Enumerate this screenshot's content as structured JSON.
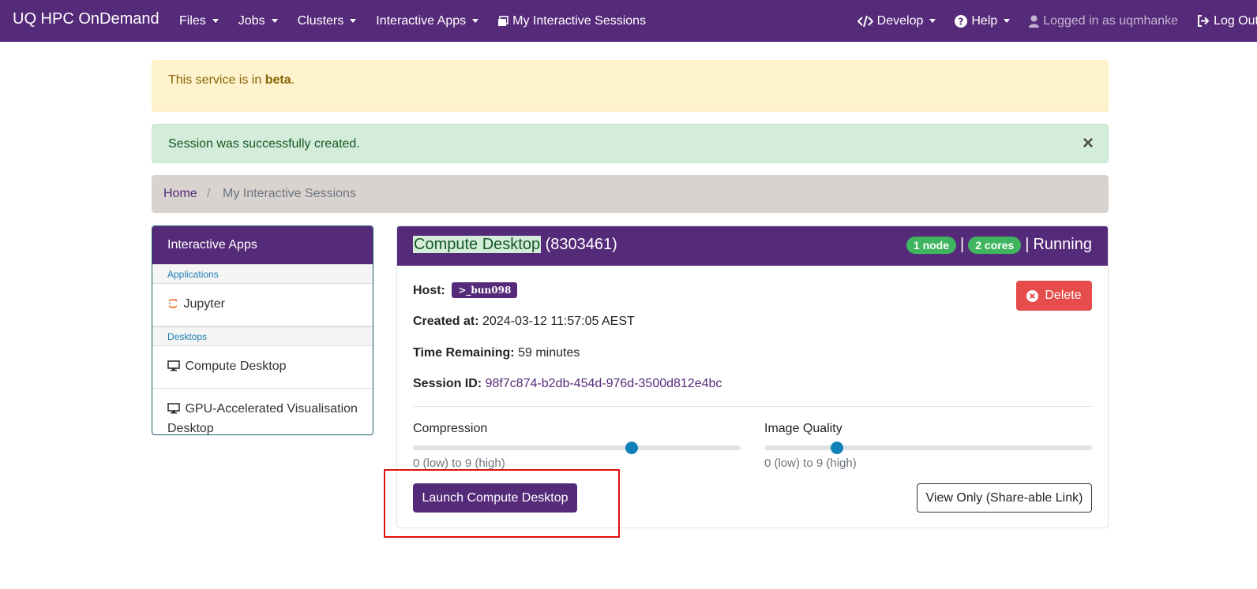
{
  "navbar": {
    "brand": "UQ HPC OnDemand",
    "left_items": [
      {
        "label": "Files"
      },
      {
        "label": "Jobs"
      },
      {
        "label": "Clusters"
      },
      {
        "label": "Interactive Apps"
      },
      {
        "label": "My Interactive Sessions",
        "icon": "sessions-icon"
      }
    ],
    "right_items": [
      {
        "label": "Develop",
        "icon": "code-icon"
      },
      {
        "label": "Help",
        "icon": "question-circle-icon"
      },
      {
        "label": "Logged in as uqmhanke",
        "icon": "user-icon"
      },
      {
        "label": "Log Out",
        "icon": "sign-out-icon"
      }
    ]
  },
  "alerts": {
    "beta_prefix": "This service is in ",
    "beta_strong": "beta",
    "beta_suffix": ".",
    "success": "Session was successfully created.",
    "close": "×"
  },
  "breadcrumb": {
    "home": "Home",
    "separator": "/",
    "current": "My Interactive Sessions"
  },
  "sidebar": {
    "header": "Interactive Apps",
    "categories": [
      {
        "label": "Applications",
        "items": [
          {
            "label": "Jupyter",
            "icon": "jupyter-icon"
          }
        ]
      },
      {
        "label": "Desktops",
        "items": [
          {
            "label": "Compute Desktop",
            "icon": "desktop-icon"
          },
          {
            "label": "GPU-Accelerated Visualisation Desktop",
            "icon": "desktop-icon"
          }
        ]
      }
    ]
  },
  "session": {
    "title": "Compute Desktop",
    "job_id": "(8303461)",
    "nodes": "1 node",
    "cores": "2 cores",
    "separator": "|",
    "status": "Running",
    "host_label": "Host:",
    "host": ">_bun098",
    "created_label": "Created at:",
    "created": "2024-03-12 11:57:05 AEST",
    "time_label": "Time Remaining:",
    "time": "59 minutes",
    "session_label": "Session ID:",
    "session_id": "98f7c874-b2db-454d-976d-3500d812e4bc",
    "delete": "Delete",
    "compression": {
      "label": "Compression",
      "hint": "0 (low) to 9 (high)",
      "value": 6,
      "min": 0,
      "max": 9
    },
    "image_quality": {
      "label": "Image Quality",
      "hint": "0 (low) to 9 (high)",
      "value": 2,
      "min": 0,
      "max": 9
    },
    "launch": "Launch Compute Desktop",
    "view_only": "View Only (Share-able Link)"
  },
  "colors": {
    "brand": "#552a79",
    "success": "#3fb55f",
    "danger": "#e74c4c",
    "annotation": "#e01010"
  }
}
